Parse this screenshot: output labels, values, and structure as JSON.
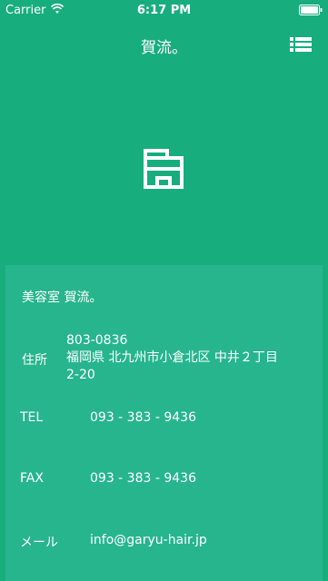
{
  "status_bar": {
    "carrier": "Carrier",
    "time": "6:17 PM",
    "wifi_icon": "wifi-icon",
    "battery_icon": "battery-icon"
  },
  "nav": {
    "title": "賀流。",
    "menu_icon": "list-icon"
  },
  "hero": {
    "icon": "storefront-icon"
  },
  "info": {
    "shop_name": "美容室 賀流。",
    "address": {
      "label": "住所",
      "postal": "803-0836",
      "line1": "福岡県 北九州市小倉北区 中井２丁目",
      "line2": "2-20"
    },
    "tel": {
      "label": "TEL",
      "value": "093 - 383 - 9436"
    },
    "fax": {
      "label": "FAX",
      "value": "093 - 383 - 9436"
    },
    "email": {
      "label": "メール",
      "value": "info@garyu-hair.jp"
    }
  },
  "colors": {
    "background": "#18ad7c",
    "card": "#27b58d",
    "text": "#ffffff"
  }
}
